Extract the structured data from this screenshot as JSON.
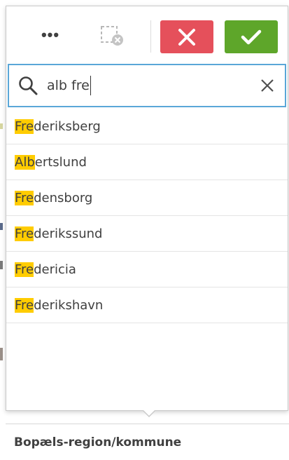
{
  "toolbar": {
    "more_icon": "more-horizontal-icon",
    "clear_selections_icon": "clear-selections-icon",
    "cancel_icon": "x-icon",
    "confirm_icon": "check-icon",
    "colors": {
      "cancel": "#e5505b",
      "confirm": "#5ea62a"
    }
  },
  "search": {
    "value": "alb fre",
    "placeholder": "",
    "search_icon": "search-icon",
    "clear_icon": "close-icon",
    "focus_color": "#5aa7d8"
  },
  "results": [
    {
      "match": "Fre",
      "rest": "deriksberg"
    },
    {
      "match": "Alb",
      "rest": "ertslund"
    },
    {
      "match": "Fre",
      "rest": "densborg"
    },
    {
      "match": "Fre",
      "rest": "derikssund"
    },
    {
      "match": "Fre",
      "rest": "dericia"
    },
    {
      "match": "Fre",
      "rest": "derikshavn"
    }
  ],
  "highlight_color": "#ffcc00",
  "field": {
    "label": "Bopæls-region/kommune"
  }
}
